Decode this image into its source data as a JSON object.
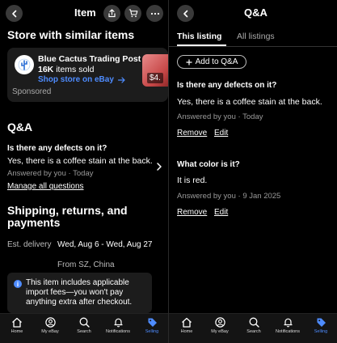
{
  "left": {
    "header": {
      "title": "Item"
    },
    "store": {
      "section_title": "Store with similar items",
      "name": "Blue Cactus Trading Post",
      "sold_count": "16K",
      "sold_suffix": "items sold",
      "link": "Shop store on eBay",
      "sponsored": "Sponsored",
      "thumb_price": "$4."
    },
    "qa": {
      "section_title": "Q&A",
      "question": "Is there any defects on it?",
      "answer": "Yes, there is a coffee stain at the back.",
      "meta": "Answered by you · Today",
      "manage_link": "Manage all questions"
    },
    "shipping": {
      "title": "Shipping, returns, and payments",
      "delivery_label": "Est. delivery",
      "delivery_value": "Wed, Aug 6 - Wed, Aug 27",
      "delivery_from": "From SZ, China"
    },
    "info": {
      "icon": "i",
      "text": "This item includes applicable import fees—you won't pay anything extra after checkout."
    }
  },
  "right": {
    "header": {
      "title": "Q&A"
    },
    "tabs": [
      {
        "label": "This listing",
        "active": true
      },
      {
        "label": "All listings",
        "active": false
      }
    ],
    "add_button": "Add to Q&A",
    "items": [
      {
        "question": "Is there any defects on it?",
        "answer": "Yes, there is a coffee stain at the back.",
        "meta": "Answered by you · Today",
        "remove": "Remove",
        "edit": "Edit"
      },
      {
        "question": "What color is it?",
        "answer": "It is red.",
        "meta": "Answered by you · 9 Jan 2025",
        "remove": "Remove",
        "edit": "Edit"
      }
    ]
  },
  "nav": {
    "items": [
      {
        "label": "Home",
        "icon": "home-icon"
      },
      {
        "label": "My eBay",
        "icon": "user-icon"
      },
      {
        "label": "Search",
        "icon": "search-icon"
      },
      {
        "label": "Notifications",
        "icon": "bell-icon"
      },
      {
        "label": "Selling",
        "icon": "tag-icon",
        "active": true
      }
    ]
  },
  "colors": {
    "accent": "#4e8cff",
    "background": "#000000",
    "card": "#1c1c1c"
  }
}
